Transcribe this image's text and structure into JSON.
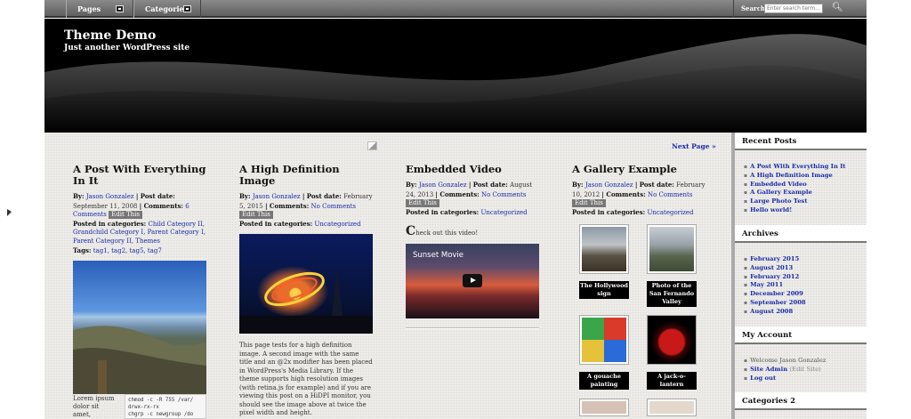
{
  "nav": {
    "pages_label": "Pages",
    "categories_label": "Categories",
    "search_label": "Search:",
    "search_placeholder": "Enter search term..."
  },
  "header": {
    "title": "Theme Demo",
    "description": "Just another WordPress site"
  },
  "main": {
    "next_page": "Next Page »"
  },
  "posts": [
    {
      "title": "A Post With Everything In It",
      "by_label": "By:",
      "author": "Jason Gonzalez",
      "date_label": "| Post date:",
      "date": "September 11, 2008",
      "comments_label": "| Comments:",
      "comments": "6 Comments",
      "edit": "Edit This",
      "categories_label": "Posted in categories:",
      "categories": "Child Category II, Grandchild Category I, Parent Category I, Parent Category II, Themes",
      "tags_label": "Tags:",
      "tags": "tag1, tag2, tag5, tag7",
      "lorem": "Lorem ipsum dolor sit amet, consectetuer",
      "code": "chmod -c -R 755 /var/\ndrwx-rx-rx\nchgrp -c newgroup /do"
    },
    {
      "title": "A High Definition Image",
      "by_label": "By:",
      "author": "Jason Gonzalez",
      "date_label": "| Post date:",
      "date": "February 5, 2015",
      "comments_label": "| Comments:",
      "comments": "No Comments",
      "edit": "Edit This",
      "categories_label": "Posted in categories:",
      "categories": "Uncategorized",
      "body": "This page tests for a high definition image. A second image with the same title and an @2x modifier has been placed in WordPress's Media Library. If the theme supports high resolution images (with retina.js for example) and if you are viewing this post on a HiDPI monitor, you should see the image above at twice the pixel width and height."
    },
    {
      "title": "Embedded Video",
      "by_label": "By:",
      "author": "Jason Gonzalez",
      "date_label": "| Post date:",
      "date": "August 24, 2013",
      "comments_label": "| Comments:",
      "comments": "No Comments",
      "edit": "Edit This",
      "categories_label": "Posted in categories:",
      "categories": "Uncategorized",
      "intro_drop": "C",
      "intro_rest": "heck out this video!",
      "video_title": "Sunset Movie"
    },
    {
      "title": "A Gallery Example",
      "by_label": "By:",
      "author": "Jason Gonzalez",
      "date_label": "| Post date:",
      "date": "February 10, 2012",
      "comments_label": "| Comments:",
      "comments": "No Comments",
      "edit": "Edit This",
      "categories_label": "Posted in categories:",
      "categories": "Uncategorized",
      "captions": [
        "The Hollywood sign",
        "Photo of the San Fernando Valley",
        "A gouache painting",
        "A jack-o-lantern"
      ]
    }
  ],
  "sidebar": {
    "recent_title": "Recent Posts",
    "recent": [
      "A Post With Everything In It",
      "A High Definition Image",
      "Embedded Video",
      "A Gallery Example",
      "Large Photo Test",
      "Hello world!"
    ],
    "archives_title": "Archives",
    "archives": [
      "February 2015",
      "August 2013",
      "February 2012",
      "May 2011",
      "December 2009",
      "September 2008",
      "August 2008"
    ],
    "account_title": "My Account",
    "welcome": "Welcome Jason Gonzalez",
    "site_admin": "Site Admin",
    "edit_site": "(Edit Site)",
    "logout": "Log out",
    "categories_title": "Categories 2"
  }
}
